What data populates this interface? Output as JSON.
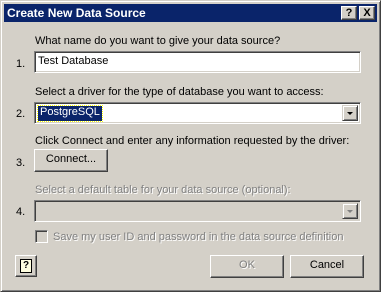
{
  "window": {
    "title": "Create New Data Source",
    "help_button": "?",
    "close_button": "X"
  },
  "steps": [
    {
      "number": "1.",
      "prompt": "What name do you want to give your data source?",
      "input_value": "Test Database"
    },
    {
      "number": "2.",
      "prompt": "Select a driver for the type of database you want to access:",
      "selected_driver": "PostgreSQL"
    },
    {
      "number": "3.",
      "prompt": "Click Connect and enter any information requested by the driver:",
      "button_label": "Connect..."
    },
    {
      "number": "4.",
      "prompt": "Select a default table for your data source (optional):",
      "selected_table": ""
    }
  ],
  "save_credentials": {
    "label": "Save my user ID and password in the data source definition",
    "checked": false
  },
  "footer": {
    "ok_label": "OK",
    "cancel_label": "Cancel",
    "help_icon": "help-book-icon"
  },
  "colors": {
    "titlebar": "#0a246a",
    "face": "#d4d0c8",
    "selection": "#0a246a"
  }
}
